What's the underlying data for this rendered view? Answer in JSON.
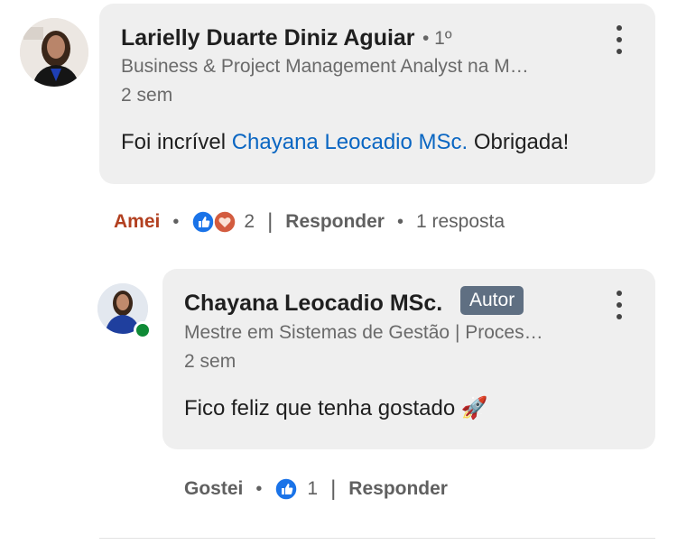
{
  "comments": [
    {
      "author": "Larielly Duarte Diniz Aguiar",
      "degree": "• 1º",
      "headline": "Business & Project Management Analyst na M…",
      "time": "2 sem",
      "text_prefix": "Foi incrível ",
      "mention": "Chayana Leocadio MSc.",
      "text_suffix": " Obrigada!",
      "actions": {
        "reaction": "Amei",
        "reaction_count": "2",
        "reply": "Responder",
        "replies": "1 resposta"
      }
    },
    {
      "author": "Chayana Leocadio MSc.",
      "badge": "Autor",
      "headline": "Mestre em Sistemas de Gestão | Proces…",
      "time": "2 sem",
      "text": "Fico feliz que tenha gostado 🚀",
      "actions": {
        "reaction": "Gostei",
        "reaction_count": "1",
        "reply": "Responder"
      }
    }
  ],
  "separators": {
    "dot": "•",
    "bar": "|"
  },
  "icons": [
    "avatar",
    "more-options-icon",
    "like-reaction-icon",
    "love-reaction-icon",
    "online-status-icon"
  ],
  "colors": {
    "mention": "#0a66c2",
    "love_reaction": "#b24020",
    "badge_bg": "#5f6f82",
    "bubble_bg": "#efefef",
    "online": "#0f8a36"
  }
}
